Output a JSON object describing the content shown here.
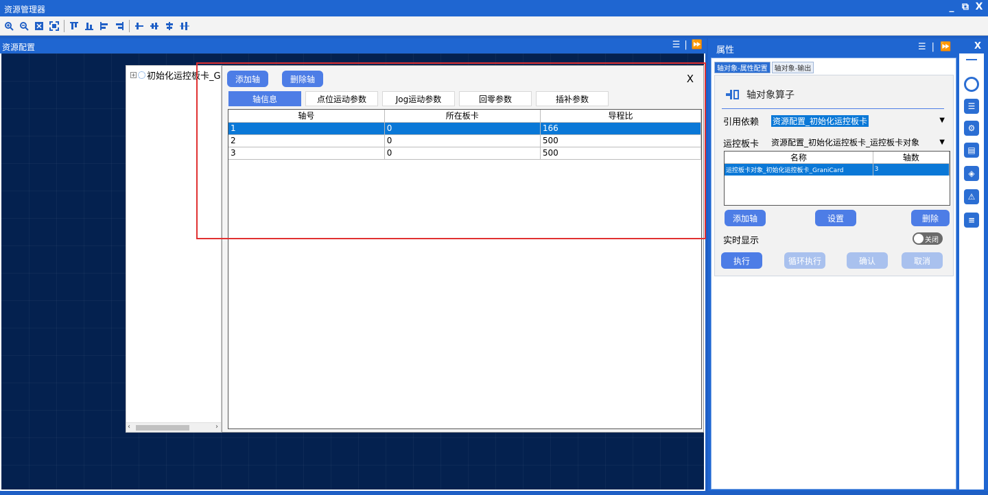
{
  "window": {
    "title": "资源管理器",
    "controls": [
      "_",
      "⧉",
      "X"
    ]
  },
  "toolbar": {
    "icons": [
      "zoom-in-icon",
      "zoom-out-icon",
      "fit-icon",
      "fullscreen-icon",
      "align-top-icon",
      "align-bottom-icon",
      "align-left-icon",
      "align-right-icon",
      "distribute-h-icon",
      "distribute-center-icon",
      "distribute-v-icon",
      "distribute-v2-icon"
    ]
  },
  "left_panel": {
    "title": "资源配置"
  },
  "tree": {
    "root_label": "初始化运控板卡_G"
  },
  "dialog": {
    "add_axis": "添加轴",
    "delete_axis": "删除轴",
    "close": "X",
    "tabs": [
      "轴信息",
      "点位运动参数",
      "Jog运动参数",
      "回零参数",
      "插补参数"
    ],
    "columns": [
      "轴号",
      "所在板卡",
      "导程比"
    ],
    "rows": [
      [
        "1",
        "0",
        "166"
      ],
      [
        "2",
        "0",
        "500"
      ],
      [
        "3",
        "0",
        "500"
      ]
    ]
  },
  "properties": {
    "title": "属性",
    "close": "X",
    "tabs": [
      "轴对象-属性配置",
      "轴对象-输出"
    ],
    "operator_title": "轴对象算子",
    "ref_label": "引用依赖",
    "ref_value": "资源配置_初始化运控板卡",
    "card_label": "运控板卡",
    "card_value": "资源配置_初始化运控板卡_运控板卡对象",
    "grid_columns": [
      "名称",
      "轴数"
    ],
    "grid_rows": [
      [
        "运控板卡对象_初始化运控板卡_GraniCard",
        "3"
      ]
    ],
    "add_axis": "添加轴",
    "settings": "设置",
    "delete": "删除",
    "realtime_label": "实时显示",
    "toggle_label": "关闭",
    "execute": "执行",
    "loop_execute": "循环执行",
    "confirm": "确认",
    "cancel": "取消"
  },
  "accent_color": "#1f66d1",
  "button_color": "#4d7de6",
  "selection_color": "#0a78d7"
}
